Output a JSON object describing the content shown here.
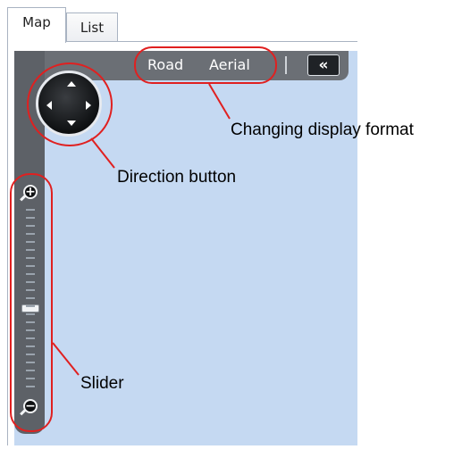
{
  "tabs": [
    {
      "label": "Map",
      "active": true
    },
    {
      "label": "List",
      "active": false
    }
  ],
  "toolbar": {
    "road_label": "Road",
    "aerial_label": "Aerial",
    "collapse_icon": "double-chevron-left-icon",
    "collapse_glyph": "«"
  },
  "direction_pad": {
    "icon": "direction-pad-icon"
  },
  "slider": {
    "zoom_in_glyph": "+",
    "zoom_out_glyph": "−",
    "zoom_in_icon": "zoom-in-icon",
    "zoom_out_icon": "zoom-out-icon",
    "level_fraction": 0.55
  },
  "annotations": {
    "display_format": "Changing display format",
    "direction": "Direction button",
    "slider": "Slider"
  },
  "colors": {
    "map_background": "#c5d9f2",
    "callout_red": "#e02020",
    "toolbar_gray": "#6b6f75"
  }
}
